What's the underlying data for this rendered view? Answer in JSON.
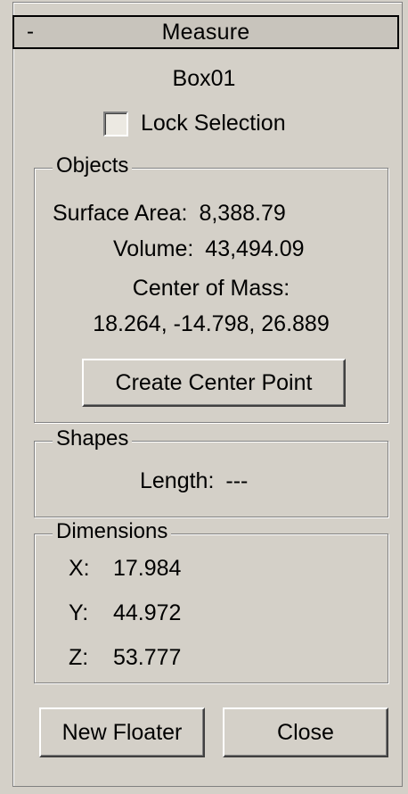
{
  "rollout": {
    "toggle": "-",
    "title": "Measure"
  },
  "selection": {
    "object_name": "Box01",
    "lock_label": "Lock Selection",
    "lock_checked": false
  },
  "objects": {
    "group_title": "Objects",
    "surface_area_label": "Surface Area:",
    "surface_area_value": "8,388.79",
    "volume_label": "Volume:",
    "volume_value": "43,494.09",
    "center_of_mass_label": "Center of Mass:",
    "center_of_mass_value": "18.264, -14.798, 26.889",
    "create_center_point_label": "Create Center Point"
  },
  "shapes": {
    "group_title": "Shapes",
    "length_label": "Length:",
    "length_value": "---"
  },
  "dimensions": {
    "group_title": "Dimensions",
    "x_label": "X:",
    "x_value": "17.984",
    "y_label": "Y:",
    "y_value": "44.972",
    "z_label": "Z:",
    "z_value": "53.777"
  },
  "footer": {
    "new_floater_label": "New Floater",
    "close_label": "Close"
  }
}
